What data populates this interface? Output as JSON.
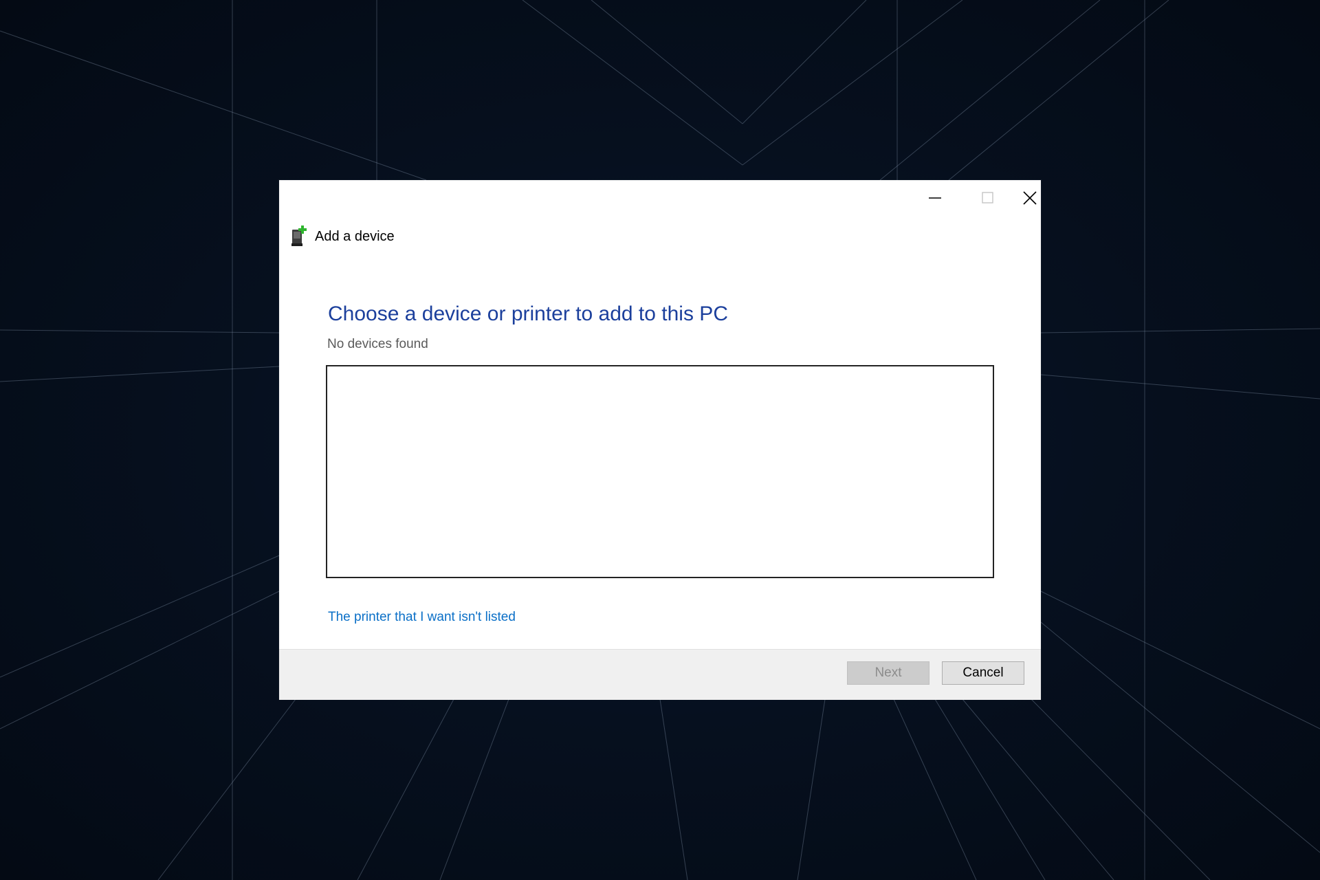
{
  "dialog": {
    "title": "Add a device",
    "heading": "Choose a device or printer to add to this PC",
    "status": "No devices found",
    "devices": [],
    "link_text": "The printer that I want isn't listed",
    "buttons": {
      "next": "Next",
      "cancel": "Cancel"
    },
    "window_controls": [
      "minimize-icon",
      "maximize-icon",
      "close-icon"
    ],
    "header_icon": "add-device-icon"
  },
  "colors": {
    "heading": "#1b3f9c",
    "link": "#0a6fc7",
    "desktop": "#06101f",
    "icon_plus": "#2fb52f"
  }
}
